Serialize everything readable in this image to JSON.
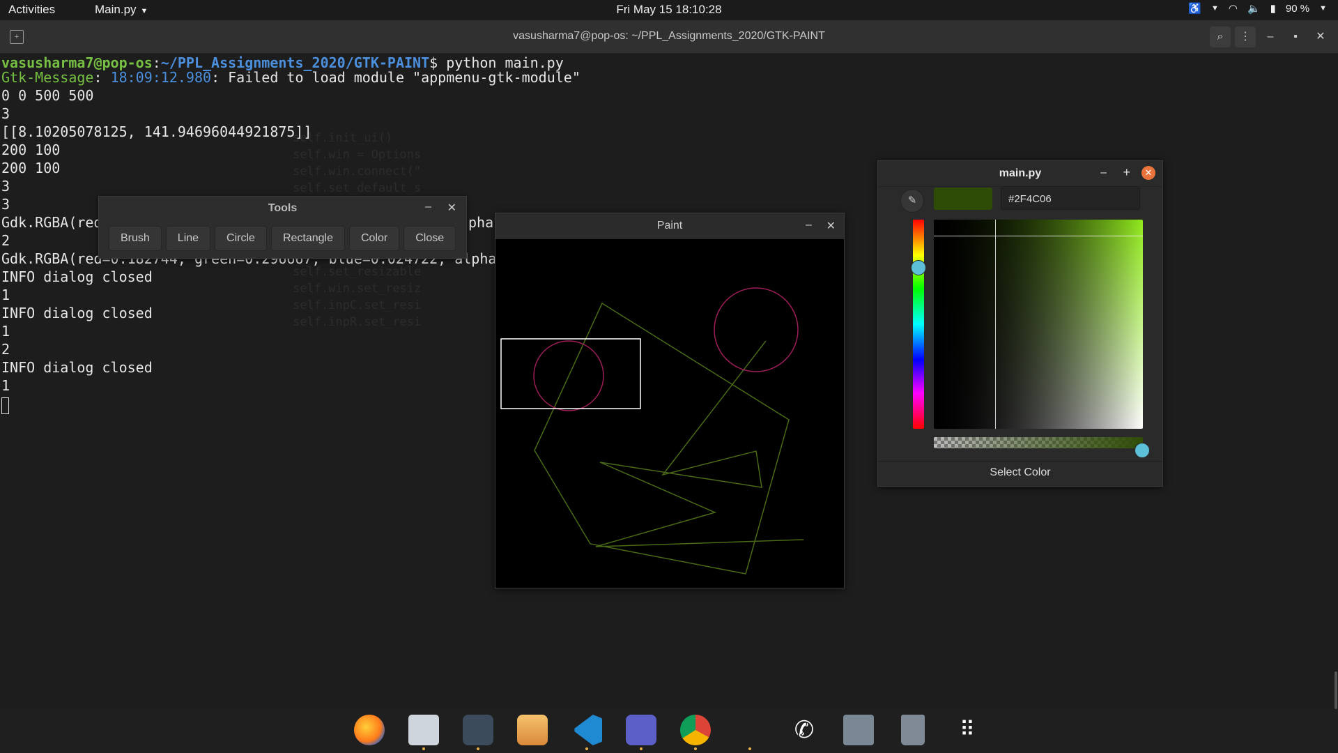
{
  "topbar": {
    "activities": "Activities",
    "app_menu": "Main.py",
    "clock": "Fri May 15  18:10:28",
    "battery": "90 %"
  },
  "terminal": {
    "title": "vasusharma7@pop-os: ~/PPL_Assignments_2020/GTK-PAINT",
    "prompt_user": "vasusharma7@pop-os",
    "prompt_path": "~/PPL_Assignments_2020/GTK-PAINT",
    "command": "$ python main.py",
    "gtk_msg_word": "Gtk-Message",
    "gtk_msg_time": "18:09:12.980",
    "gtk_msg_text": ": Failed to load module \"appmenu-gtk-module\"",
    "lines": [
      "0 0 500 500",
      "3",
      "[[8.10205078125, 141.94696044921875]]",
      "200 100",
      "200 100",
      "3",
      "3",
      "Gdk.RGBA(red",
      "2",
      "Gdk.RGBA(red=0.182744, green=0.296667, blue=0.024722, alpha",
      "INFO dialog closed",
      "1",
      "INFO dialog closed",
      "1",
      "2",
      "INFO dialog closed",
      "1"
    ],
    "line8_tail": "pha"
  },
  "tools_window": {
    "title": "Tools",
    "buttons": [
      "Brush",
      "Line",
      "Circle",
      "Rectangle",
      "Color",
      "Close"
    ]
  },
  "paint_window": {
    "title": "Paint"
  },
  "color_chooser": {
    "title": "main.py",
    "hex_value": "#2F4C06",
    "footer": "Select Color",
    "selected_color": "#2F4C06",
    "accent": "#5bc0d8"
  },
  "dock": {
    "apps": [
      "firefox-icon",
      "files-icon",
      "terminal-icon",
      "app-store-icon",
      "vscode-icon",
      "teams-icon",
      "chrome-icon",
      "phone-icon",
      "disks-icon",
      "trash-icon",
      "app-grid-icon"
    ]
  }
}
